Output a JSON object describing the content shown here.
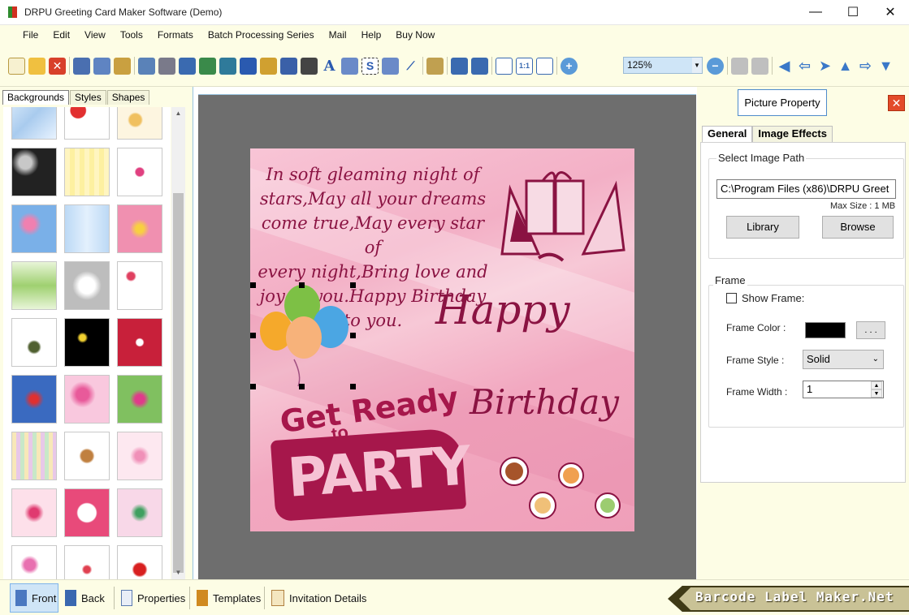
{
  "window": {
    "title": "DRPU Greeting Card Maker Software (Demo)"
  },
  "menu": [
    "File",
    "Edit",
    "View",
    "Tools",
    "Formats",
    "Batch Processing Series",
    "Mail",
    "Help",
    "Buy Now"
  ],
  "toolbar": {
    "zoom": "125%"
  },
  "left_panel": {
    "tabs": [
      "Backgrounds",
      "Styles",
      "Shapes"
    ]
  },
  "card": {
    "poem": "In soft gleaming night of\nstars,May all your dreams\ncome true,May every star of\nevery night,Bring love and\njoy to you.Happy Birthday\nto you.",
    "happy": "Happy",
    "birthday": "Birthday",
    "get_ready": "Get Ready",
    "to": "to",
    "party": "PARTY"
  },
  "properties": {
    "title": "Picture Property",
    "close": "✕",
    "tabs": [
      "General",
      "Image Effects"
    ],
    "image_path_group": "Select Image Path",
    "image_path": "C:\\Program Files (x86)\\DRPU Greet",
    "max_size": "Max Size : 1 MB",
    "library_button": "Library",
    "browse_button": "Browse",
    "frame_group": "Frame",
    "show_frame": "Show Frame:",
    "frame_color_label": "Frame Color :",
    "frame_color_button": ". . .",
    "frame_style_label": "Frame Style :",
    "frame_style_value": "Solid",
    "frame_width_label": "Frame Width :",
    "frame_width_value": "1"
  },
  "bottom": {
    "front": "Front",
    "back": "Back",
    "properties": "Properties",
    "templates": "Templates",
    "invitation": "Invitation Details",
    "brand": "Barcode Label Maker.Net"
  },
  "colors": {
    "accent_text": "#8a1342",
    "panel_bg": "#fdfde5",
    "canvas_bg": "#6e6e6e"
  }
}
